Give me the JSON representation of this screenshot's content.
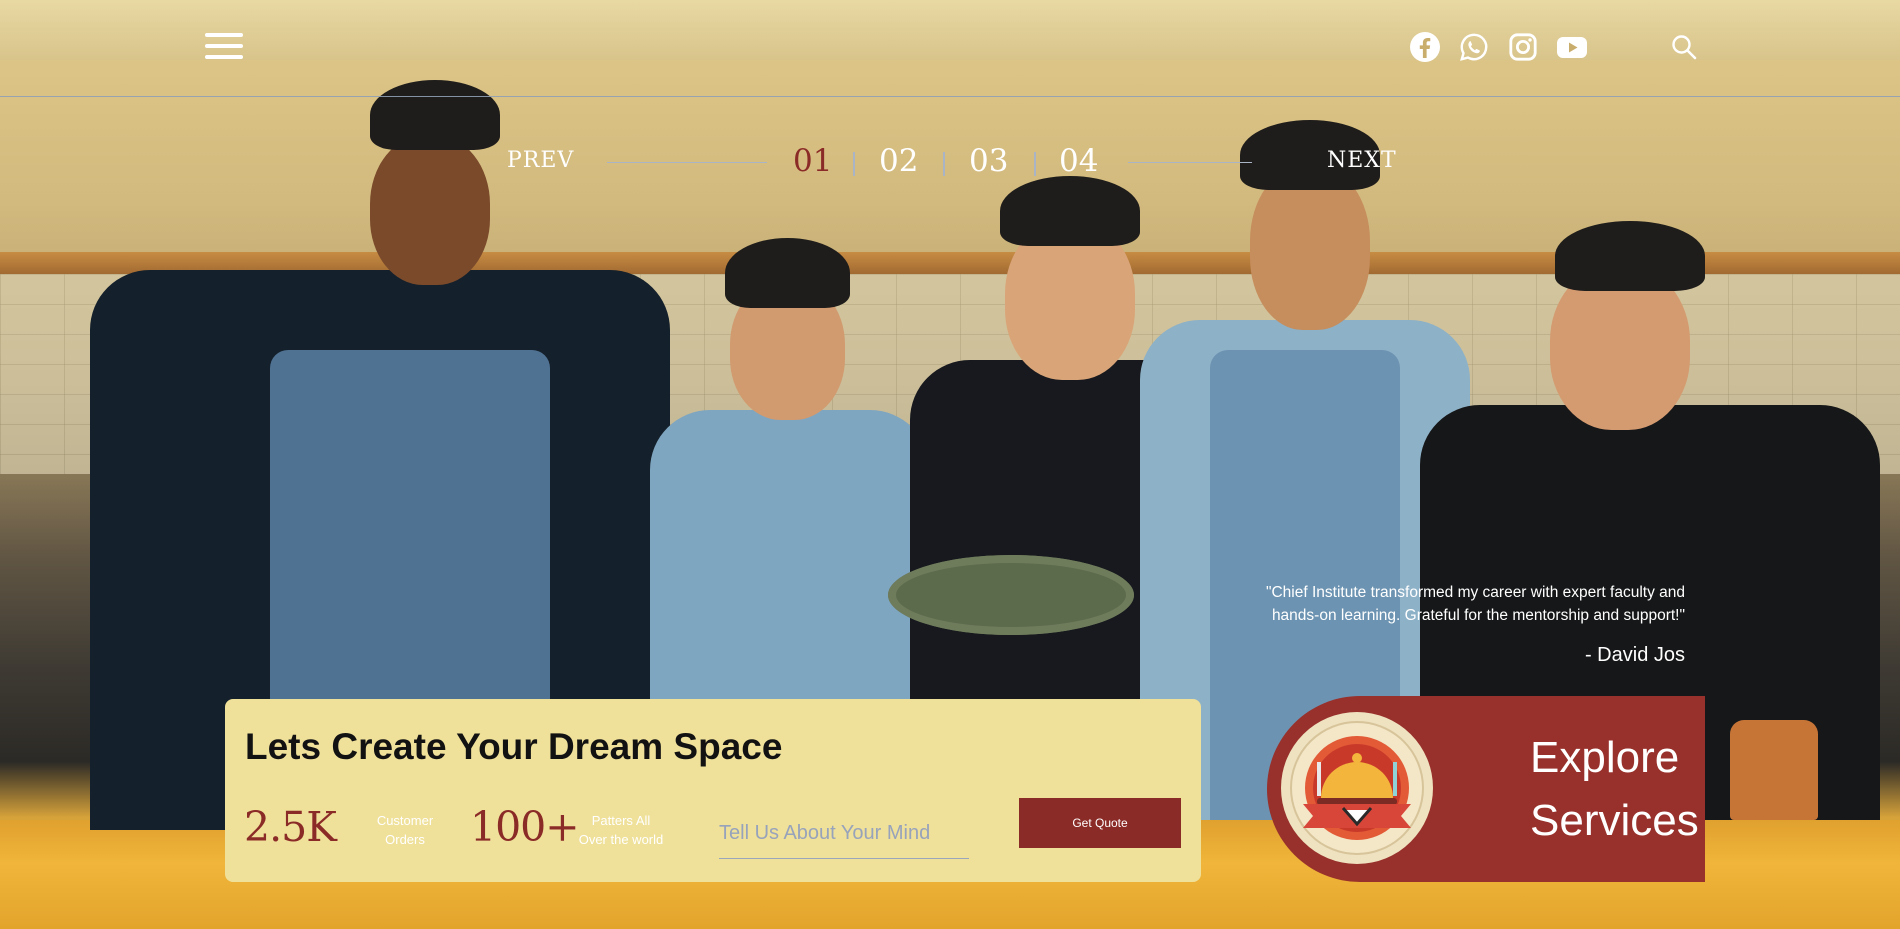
{
  "header": {
    "menu_icon": "hamburger-menu-icon",
    "social": [
      {
        "name": "facebook",
        "icon": "facebook-icon"
      },
      {
        "name": "whatsapp",
        "icon": "whatsapp-icon"
      },
      {
        "name": "instagram",
        "icon": "instagram-icon"
      },
      {
        "name": "youtube",
        "icon": "youtube-icon"
      }
    ],
    "search_icon": "search-icon"
  },
  "pager": {
    "prev_label": "PREV",
    "next_label": "NEXT",
    "pages": [
      "01",
      "02",
      "03",
      "04"
    ],
    "active": "01"
  },
  "testimonial": {
    "quote": "\"Chief Institute transformed my career with expert faculty and hands-on learning. Grateful for the mentorship and support!\"",
    "author": "- David Jos"
  },
  "cta": {
    "title": "Lets Create Your Dream Space",
    "stats": [
      {
        "value": "2.5K",
        "label_line1": "Customer",
        "label_line2": "Orders"
      },
      {
        "value": "100+",
        "label_line1": "Patters All",
        "label_line2": "Over the world"
      }
    ],
    "input_placeholder": "Tell Us About Your Mind",
    "button_label": "Get Quote"
  },
  "explore": {
    "line1": "Explore",
    "line2": "Services",
    "logo_icon": "serving-cloche-logo-icon"
  },
  "colors": {
    "accent": "#8b2b27",
    "card": "#efe09a",
    "explore_bg": "#98302b"
  }
}
